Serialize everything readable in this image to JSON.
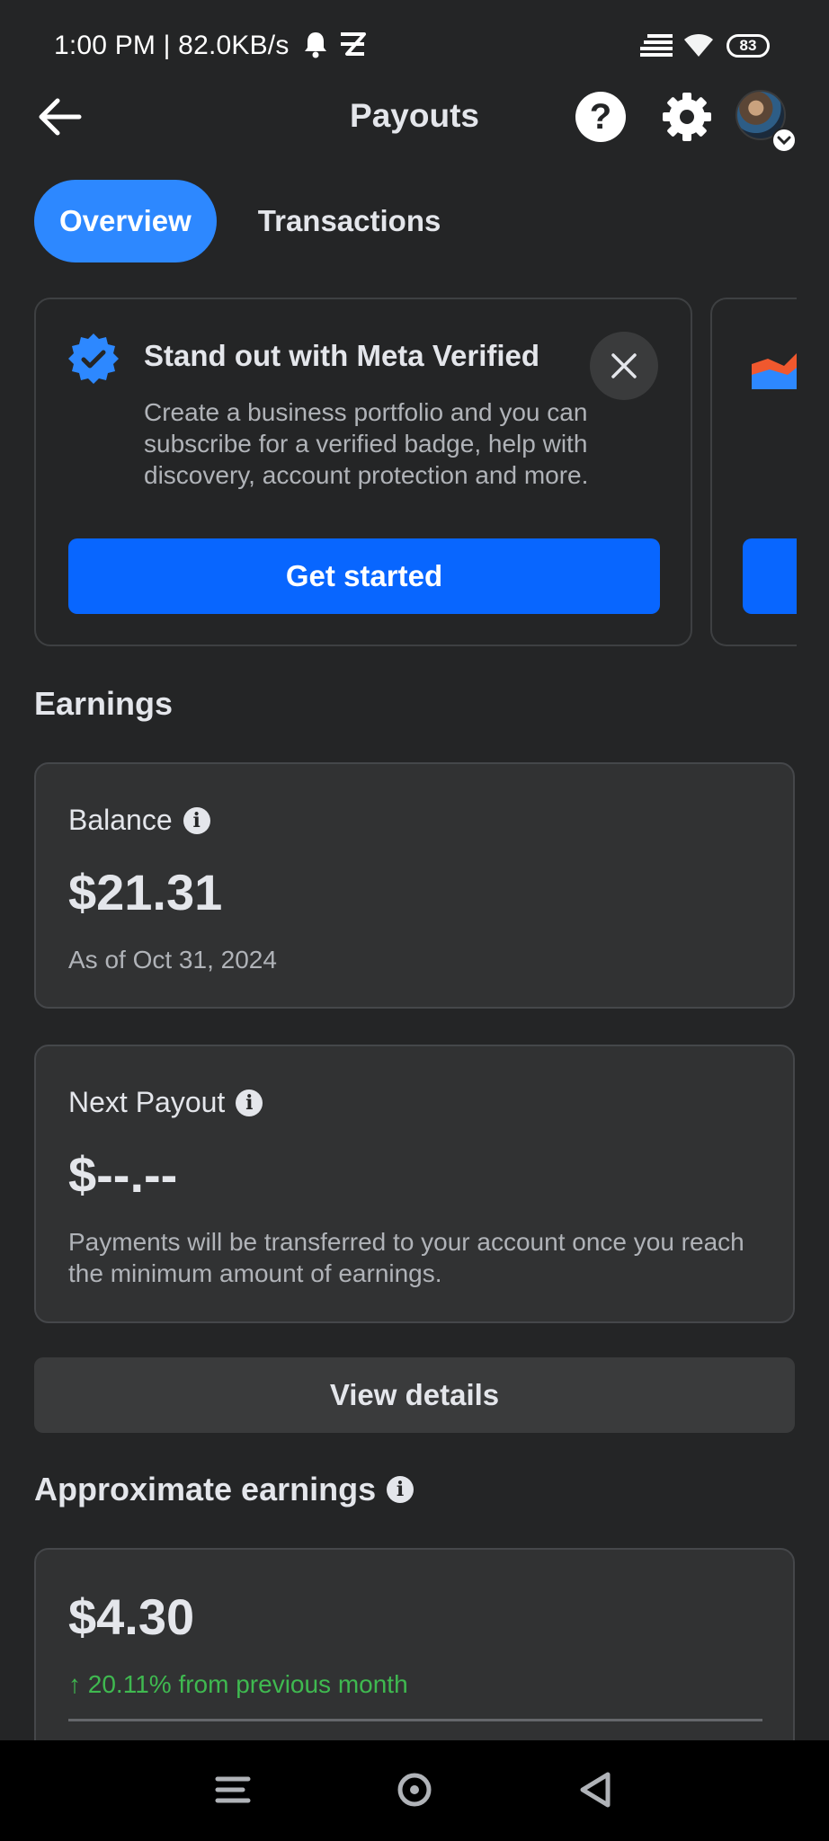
{
  "status_bar": {
    "time_speed": "1:00 PM | 82.0KB/s",
    "battery": "83",
    "icons": [
      "bell-icon",
      "app-notification-icon",
      "signal-icon",
      "wifi-icon",
      "battery-icon"
    ]
  },
  "header": {
    "title": "Payouts",
    "help_label": "?",
    "icons": [
      "back-arrow-icon",
      "help-icon",
      "gear-icon",
      "avatar",
      "chevron-down-icon"
    ]
  },
  "tabs": [
    {
      "label": "Overview",
      "active": true
    },
    {
      "label": "Transactions",
      "active": false
    }
  ],
  "promo": {
    "title": "Stand out with Meta Verified",
    "body": "Create a business portfolio and you can subscribe for a verified badge, help with discovery, account protection and more.",
    "button": "Get started",
    "icons": [
      "verified-badge-icon",
      "close-icon"
    ]
  },
  "earnings": {
    "heading": "Earnings",
    "balance": {
      "label": "Balance",
      "amount": "$21.31",
      "as_of": "As of Oct 31, 2024"
    },
    "next_payout": {
      "label": "Next Payout",
      "amount": "$--.--",
      "note": "Payments will be transferred to your account once you reach the minimum amount of earnings."
    },
    "view_details": "View details"
  },
  "approximate": {
    "heading": "Approximate earnings",
    "amount": "$4.30",
    "change": "↑ 20.11% from previous month"
  },
  "nav": {
    "icons": [
      "menu-icon",
      "home-icon",
      "back-icon"
    ]
  },
  "colors": {
    "background": "#242526",
    "accent": "#2d88ff",
    "button_blue": "#0866ff",
    "growth_green": "#3fb950"
  }
}
